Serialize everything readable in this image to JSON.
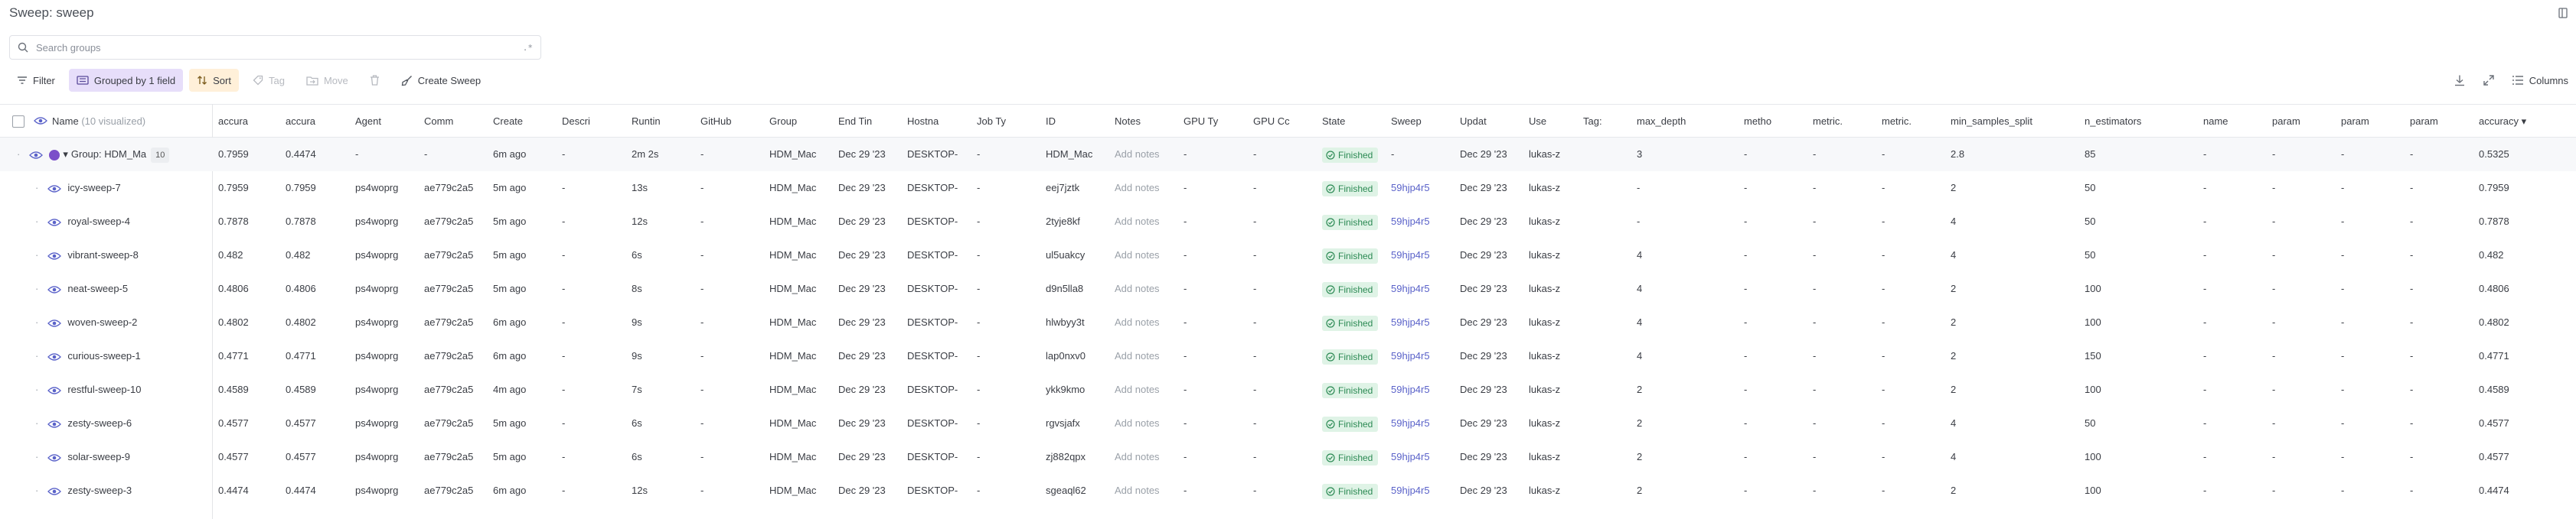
{
  "header": {
    "title": "Sweep: sweep"
  },
  "search": {
    "placeholder": "Search groups",
    "regex_label": ".*"
  },
  "toolbar": {
    "filter_label": "Filter",
    "grouped_label": "Grouped by 1 field",
    "sort_label": "Sort",
    "tag_label": "Tag",
    "move_label": "Move",
    "create_sweep_label": "Create Sweep",
    "columns_label": "Columns"
  },
  "table": {
    "name_header": "Name",
    "name_header_note": "(10 visualized)",
    "headers": [
      "accura",
      "accura",
      "Agent",
      "Comm",
      "Create",
      "Descri",
      "Runtin",
      "GitHub",
      "Group",
      "End Tin",
      "Hostna",
      "Job Ty",
      "ID",
      "Notes",
      "GPU Ty",
      "GPU Cc",
      "State",
      "Sweep",
      "Updat",
      "Use",
      "Tag:",
      "max_depth",
      "metho",
      "metric.",
      "metric.",
      "min_samples_split",
      "n_estimators",
      "name",
      "param",
      "param",
      "param",
      "accuracy ▾"
    ],
    "group_row": {
      "name": "Group: HDM_Ma",
      "count": "10",
      "cells": [
        "0.7959",
        "0.4474",
        "-",
        "-",
        "6m ago",
        "-",
        "2m 2s",
        "-",
        "HDM_Mac",
        "Dec 29 '23",
        "DESKTOP-",
        "-",
        "HDM_Mac",
        "Add notes",
        "-",
        "-",
        "Finished",
        "-",
        "Dec 29 '23",
        "lukas-z",
        "",
        "3",
        "-",
        "-",
        "-",
        "2.8",
        "85",
        "-",
        "-",
        "-",
        "-",
        "0.5325"
      ]
    },
    "rows": [
      {
        "name": "icy-sweep-7",
        "cells": [
          "0.7959",
          "0.7959",
          "ps4woprg",
          "ae779c2a5",
          "5m ago",
          "-",
          "13s",
          "-",
          "HDM_Mac",
          "Dec 29 '23",
          "DESKTOP-",
          "-",
          "eej7jztk",
          "Add notes",
          "-",
          "-",
          "Finished",
          "59hjp4r5",
          "Dec 29 '23",
          "lukas-z",
          "",
          "-",
          "-",
          "-",
          "-",
          "2",
          "50",
          "-",
          "-",
          "-",
          "-",
          "0.7959"
        ]
      },
      {
        "name": "royal-sweep-4",
        "cells": [
          "0.7878",
          "0.7878",
          "ps4woprg",
          "ae779c2a5",
          "5m ago",
          "-",
          "12s",
          "-",
          "HDM_Mac",
          "Dec 29 '23",
          "DESKTOP-",
          "-",
          "2tyje8kf",
          "Add notes",
          "-",
          "-",
          "Finished",
          "59hjp4r5",
          "Dec 29 '23",
          "lukas-z",
          "",
          "-",
          "-",
          "-",
          "-",
          "4",
          "50",
          "-",
          "-",
          "-",
          "-",
          "0.7878"
        ]
      },
      {
        "name": "vibrant-sweep-8",
        "cells": [
          "0.482",
          "0.482",
          "ps4woprg",
          "ae779c2a5",
          "5m ago",
          "-",
          "6s",
          "-",
          "HDM_Mac",
          "Dec 29 '23",
          "DESKTOP-",
          "-",
          "ul5uakcy",
          "Add notes",
          "-",
          "-",
          "Finished",
          "59hjp4r5",
          "Dec 29 '23",
          "lukas-z",
          "",
          "4",
          "-",
          "-",
          "-",
          "4",
          "50",
          "-",
          "-",
          "-",
          "-",
          "0.482"
        ]
      },
      {
        "name": "neat-sweep-5",
        "cells": [
          "0.4806",
          "0.4806",
          "ps4woprg",
          "ae779c2a5",
          "5m ago",
          "-",
          "8s",
          "-",
          "HDM_Mac",
          "Dec 29 '23",
          "DESKTOP-",
          "-",
          "d9n5lla8",
          "Add notes",
          "-",
          "-",
          "Finished",
          "59hjp4r5",
          "Dec 29 '23",
          "lukas-z",
          "",
          "4",
          "-",
          "-",
          "-",
          "2",
          "100",
          "-",
          "-",
          "-",
          "-",
          "0.4806"
        ]
      },
      {
        "name": "woven-sweep-2",
        "cells": [
          "0.4802",
          "0.4802",
          "ps4woprg",
          "ae779c2a5",
          "6m ago",
          "-",
          "9s",
          "-",
          "HDM_Mac",
          "Dec 29 '23",
          "DESKTOP-",
          "-",
          "hlwbyy3t",
          "Add notes",
          "-",
          "-",
          "Finished",
          "59hjp4r5",
          "Dec 29 '23",
          "lukas-z",
          "",
          "4",
          "-",
          "-",
          "-",
          "2",
          "100",
          "-",
          "-",
          "-",
          "-",
          "0.4802"
        ]
      },
      {
        "name": "curious-sweep-1",
        "cells": [
          "0.4771",
          "0.4771",
          "ps4woprg",
          "ae779c2a5",
          "6m ago",
          "-",
          "9s",
          "-",
          "HDM_Mac",
          "Dec 29 '23",
          "DESKTOP-",
          "-",
          "lap0nxv0",
          "Add notes",
          "-",
          "-",
          "Finished",
          "59hjp4r5",
          "Dec 29 '23",
          "lukas-z",
          "",
          "4",
          "-",
          "-",
          "-",
          "2",
          "150",
          "-",
          "-",
          "-",
          "-",
          "0.4771"
        ]
      },
      {
        "name": "restful-sweep-10",
        "cells": [
          "0.4589",
          "0.4589",
          "ps4woprg",
          "ae779c2a5",
          "4m ago",
          "-",
          "7s",
          "-",
          "HDM_Mac",
          "Dec 29 '23",
          "DESKTOP-",
          "-",
          "ykk9kmo",
          "Add notes",
          "-",
          "-",
          "Finished",
          "59hjp4r5",
          "Dec 29 '23",
          "lukas-z",
          "",
          "2",
          "-",
          "-",
          "-",
          "2",
          "100",
          "-",
          "-",
          "-",
          "-",
          "0.4589"
        ]
      },
      {
        "name": "zesty-sweep-6",
        "cells": [
          "0.4577",
          "0.4577",
          "ps4woprg",
          "ae779c2a5",
          "5m ago",
          "-",
          "6s",
          "-",
          "HDM_Mac",
          "Dec 29 '23",
          "DESKTOP-",
          "-",
          "rgvsjafx",
          "Add notes",
          "-",
          "-",
          "Finished",
          "59hjp4r5",
          "Dec 29 '23",
          "lukas-z",
          "",
          "2",
          "-",
          "-",
          "-",
          "4",
          "50",
          "-",
          "-",
          "-",
          "-",
          "0.4577"
        ]
      },
      {
        "name": "solar-sweep-9",
        "cells": [
          "0.4577",
          "0.4577",
          "ps4woprg",
          "ae779c2a5",
          "5m ago",
          "-",
          "6s",
          "-",
          "HDM_Mac",
          "Dec 29 '23",
          "DESKTOP-",
          "-",
          "zj882qpx",
          "Add notes",
          "-",
          "-",
          "Finished",
          "59hjp4r5",
          "Dec 29 '23",
          "lukas-z",
          "",
          "2",
          "-",
          "-",
          "-",
          "4",
          "100",
          "-",
          "-",
          "-",
          "-",
          "0.4577"
        ]
      },
      {
        "name": "zesty-sweep-3",
        "cells": [
          "0.4474",
          "0.4474",
          "ps4woprg",
          "ae779c2a5",
          "6m ago",
          "-",
          "12s",
          "-",
          "HDM_Mac",
          "Dec 29 '23",
          "DESKTOP-",
          "-",
          "sgeaql62",
          "Add notes",
          "-",
          "-",
          "Finished",
          "59hjp4r5",
          "Dec 29 '23",
          "lukas-z",
          "",
          "2",
          "-",
          "-",
          "-",
          "2",
          "100",
          "-",
          "-",
          "-",
          "-",
          "0.4474"
        ]
      }
    ]
  },
  "colors": {
    "group_dot": "#7b4fc9",
    "finished_bg": "#dff3e6",
    "finished_fg": "#2c8a54",
    "link": "#5a62c9",
    "grouped_bg": "#e7defa",
    "sort_bg": "#fff0d9"
  }
}
